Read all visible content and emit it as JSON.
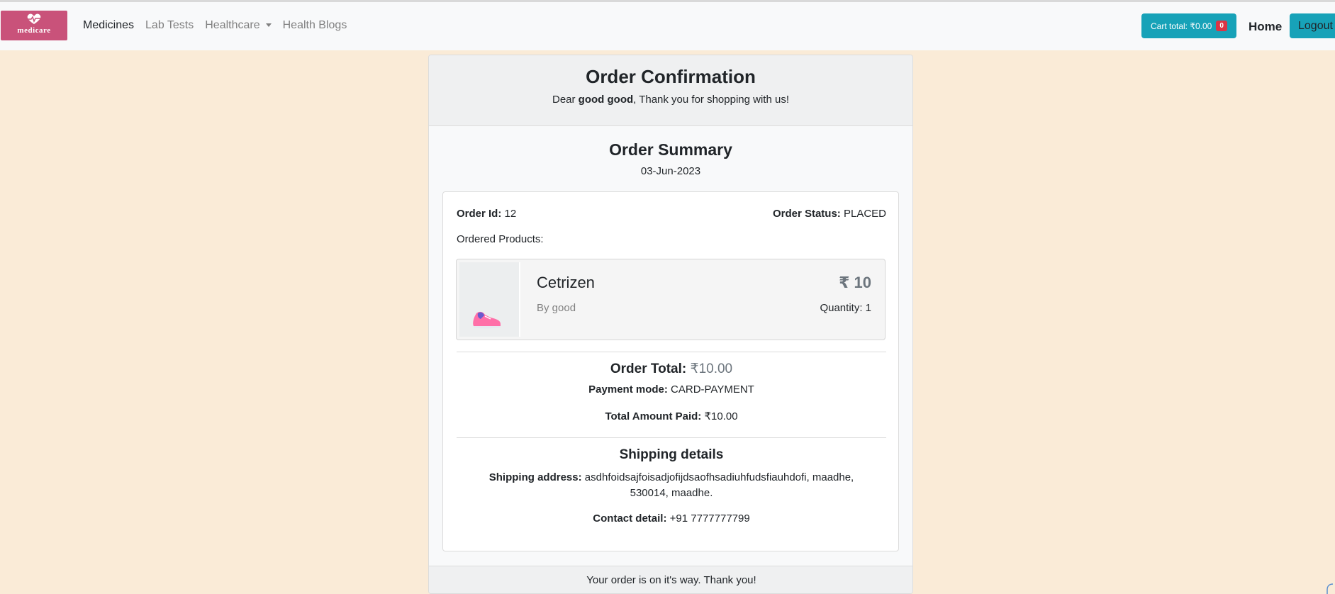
{
  "nav": {
    "brand": "medicare",
    "links": [
      "Medicines",
      "Lab Tests",
      "Healthcare",
      "Health Blogs"
    ],
    "cart_label": "Cart total: ₹0.00",
    "cart_count": "0",
    "home": "Home",
    "logout": "Logout"
  },
  "confirmation": {
    "title": "Order Confirmation",
    "greeting_prefix": "Dear ",
    "customer_name": "good good",
    "greeting_suffix": ", Thank you for shopping with us!"
  },
  "summary": {
    "title": "Order Summary",
    "date": "03-Jun-2023",
    "order_id_label": "Order Id:",
    "order_id": "12",
    "status_label": "Order Status:",
    "status": "PLACED",
    "ordered_products_label": "Ordered Products:"
  },
  "product": {
    "name": "Cetrizen",
    "price": "₹ 10",
    "by": "By good",
    "quantity": "Quantity: 1"
  },
  "totals": {
    "order_total_label": "Order Total:",
    "order_total": "₹10.00",
    "payment_label": "Payment mode:",
    "payment_mode": "CARD-PAYMENT",
    "paid_label": "Total Amount Paid:",
    "paid": "₹10.00"
  },
  "shipping": {
    "title": "Shipping details",
    "address_label": "Shipping address:",
    "address": "asdhfoidsajfoisadjofijdsaofhsadiuhfudsfiauhdofi, maadhe, 530014, maadhe.",
    "contact_label": "Contact detail:",
    "contact": "+91 7777777799"
  },
  "footer": "Your order is on it's way. Thank you!",
  "colors": {
    "page_bg": "#faebd7",
    "brand": "#c9527a",
    "accent": "#17a2b8",
    "badge": "#dc3545"
  }
}
